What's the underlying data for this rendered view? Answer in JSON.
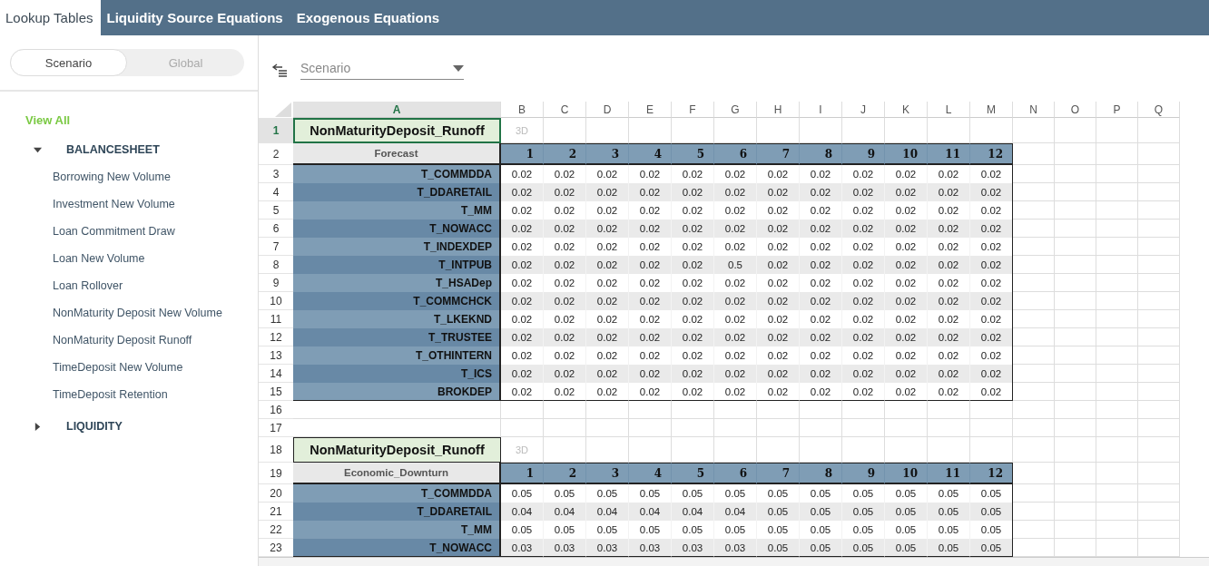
{
  "tabs": [
    {
      "label": "Lookup Tables",
      "selected": true
    },
    {
      "label": "Liquidity Source Equations",
      "selected": false
    },
    {
      "label": "Exogenous Equations",
      "selected": false
    }
  ],
  "sidebar": {
    "toggle": [
      {
        "label": "Scenario",
        "selected": true
      },
      {
        "label": "Global",
        "selected": false
      }
    ],
    "view_all": "View All",
    "tree": [
      {
        "label": "BALANCESHEET",
        "expanded": true,
        "children": [
          {
            "label": "Borrowing New Volume"
          },
          {
            "label": "Investment New Volume"
          },
          {
            "label": "Loan Commitment Draw"
          },
          {
            "label": "Loan New Volume"
          },
          {
            "label": "Loan Rollover"
          },
          {
            "label": "NonMaturity Deposit New Volume"
          },
          {
            "label": "NonMaturity Deposit Runoff"
          },
          {
            "label": "TimeDeposit New Volume"
          },
          {
            "label": "TimeDeposit Retention"
          }
        ]
      },
      {
        "label": "LIQUIDITY",
        "expanded": false
      }
    ]
  },
  "toolbar": {
    "dropdown": "Scenario"
  },
  "sheet": {
    "columns": [
      {
        "letter": "A",
        "selected": true
      },
      {
        "letter": "B",
        "selected": false
      },
      {
        "letter": "C",
        "selected": false
      },
      {
        "letter": "D",
        "selected": false
      },
      {
        "letter": "E",
        "selected": false
      },
      {
        "letter": "F",
        "selected": false
      },
      {
        "letter": "G",
        "selected": false
      },
      {
        "letter": "H",
        "selected": false
      },
      {
        "letter": "I",
        "selected": false
      },
      {
        "letter": "J",
        "selected": false
      },
      {
        "letter": "K",
        "selected": false
      },
      {
        "letter": "L",
        "selected": false
      },
      {
        "letter": "M",
        "selected": false
      },
      {
        "letter": "N",
        "selected": false
      },
      {
        "letter": "O",
        "selected": false
      },
      {
        "letter": "P",
        "selected": false
      },
      {
        "letter": "Q",
        "selected": false
      }
    ],
    "rows": [
      {
        "number": "1",
        "kind": "title",
        "selected": true,
        "label": "NonMaturityDeposit_Runoff",
        "tag": "3D"
      },
      {
        "number": "2",
        "kind": "header",
        "selected": false,
        "label": "Forecast",
        "values": [
          "1",
          "2",
          "3",
          "4",
          "5",
          "6",
          "7",
          "8",
          "9",
          "10",
          "11",
          "12"
        ]
      },
      {
        "number": "3",
        "kind": "data",
        "selected": false,
        "label": "T_COMMDDA",
        "values": [
          "0.02",
          "0.02",
          "0.02",
          "0.02",
          "0.02",
          "0.02",
          "0.02",
          "0.02",
          "0.02",
          "0.02",
          "0.02",
          "0.02"
        ]
      },
      {
        "number": "4",
        "kind": "data",
        "selected": false,
        "label": "T_DDARETAIL",
        "values": [
          "0.02",
          "0.02",
          "0.02",
          "0.02",
          "0.02",
          "0.02",
          "0.02",
          "0.02",
          "0.02",
          "0.02",
          "0.02",
          "0.02"
        ]
      },
      {
        "number": "5",
        "kind": "data",
        "selected": false,
        "label": "T_MM",
        "values": [
          "0.02",
          "0.02",
          "0.02",
          "0.02",
          "0.02",
          "0.02",
          "0.02",
          "0.02",
          "0.02",
          "0.02",
          "0.02",
          "0.02"
        ]
      },
      {
        "number": "6",
        "kind": "data",
        "selected": false,
        "label": "T_NOWACC",
        "values": [
          "0.02",
          "0.02",
          "0.02",
          "0.02",
          "0.02",
          "0.02",
          "0.02",
          "0.02",
          "0.02",
          "0.02",
          "0.02",
          "0.02"
        ]
      },
      {
        "number": "7",
        "kind": "data",
        "selected": false,
        "label": "T_INDEXDEP",
        "values": [
          "0.02",
          "0.02",
          "0.02",
          "0.02",
          "0.02",
          "0.02",
          "0.02",
          "0.02",
          "0.02",
          "0.02",
          "0.02",
          "0.02"
        ]
      },
      {
        "number": "8",
        "kind": "data",
        "selected": false,
        "label": "T_INTPUB",
        "values": [
          "0.02",
          "0.02",
          "0.02",
          "0.02",
          "0.02",
          "0.5",
          "0.02",
          "0.02",
          "0.02",
          "0.02",
          "0.02",
          "0.02"
        ]
      },
      {
        "number": "9",
        "kind": "data",
        "selected": false,
        "label": "T_HSADep",
        "values": [
          "0.02",
          "0.02",
          "0.02",
          "0.02",
          "0.02",
          "0.02",
          "0.02",
          "0.02",
          "0.02",
          "0.02",
          "0.02",
          "0.02"
        ]
      },
      {
        "number": "10",
        "kind": "data",
        "selected": false,
        "label": "T_COMMCHCK",
        "values": [
          "0.02",
          "0.02",
          "0.02",
          "0.02",
          "0.02",
          "0.02",
          "0.02",
          "0.02",
          "0.02",
          "0.02",
          "0.02",
          "0.02"
        ]
      },
      {
        "number": "11",
        "kind": "data",
        "selected": false,
        "label": "T_LKEKND",
        "values": [
          "0.02",
          "0.02",
          "0.02",
          "0.02",
          "0.02",
          "0.02",
          "0.02",
          "0.02",
          "0.02",
          "0.02",
          "0.02",
          "0.02"
        ]
      },
      {
        "number": "12",
        "kind": "data",
        "selected": false,
        "label": "T_TRUSTEE",
        "values": [
          "0.02",
          "0.02",
          "0.02",
          "0.02",
          "0.02",
          "0.02",
          "0.02",
          "0.02",
          "0.02",
          "0.02",
          "0.02",
          "0.02"
        ]
      },
      {
        "number": "13",
        "kind": "data",
        "selected": false,
        "label": "T_OTHINTERN",
        "values": [
          "0.02",
          "0.02",
          "0.02",
          "0.02",
          "0.02",
          "0.02",
          "0.02",
          "0.02",
          "0.02",
          "0.02",
          "0.02",
          "0.02"
        ]
      },
      {
        "number": "14",
        "kind": "data",
        "selected": false,
        "label": "T_ICS",
        "values": [
          "0.02",
          "0.02",
          "0.02",
          "0.02",
          "0.02",
          "0.02",
          "0.02",
          "0.02",
          "0.02",
          "0.02",
          "0.02",
          "0.02"
        ]
      },
      {
        "number": "15",
        "kind": "data",
        "selected": false,
        "label": "BROKDEP",
        "values": [
          "0.02",
          "0.02",
          "0.02",
          "0.02",
          "0.02",
          "0.02",
          "0.02",
          "0.02",
          "0.02",
          "0.02",
          "0.02",
          "0.02"
        ]
      },
      {
        "number": "16",
        "kind": "empty",
        "selected": false
      },
      {
        "number": "17",
        "kind": "empty",
        "selected": false
      },
      {
        "number": "18",
        "kind": "title",
        "selected": false,
        "label": "NonMaturityDeposit_Runoff",
        "tag": "3D"
      },
      {
        "number": "19",
        "kind": "header",
        "selected": false,
        "label": "Economic_Downturn",
        "values": [
          "1",
          "2",
          "3",
          "4",
          "5",
          "6",
          "7",
          "8",
          "9",
          "10",
          "11",
          "12"
        ]
      },
      {
        "number": "20",
        "kind": "data",
        "selected": false,
        "label": "T_COMMDDA",
        "values": [
          "0.05",
          "0.05",
          "0.05",
          "0.05",
          "0.05",
          "0.05",
          "0.05",
          "0.05",
          "0.05",
          "0.05",
          "0.05",
          "0.05"
        ]
      },
      {
        "number": "21",
        "kind": "data",
        "selected": false,
        "label": "T_DDARETAIL",
        "values": [
          "0.04",
          "0.04",
          "0.04",
          "0.04",
          "0.04",
          "0.04",
          "0.05",
          "0.05",
          "0.05",
          "0.05",
          "0.05",
          "0.05"
        ]
      },
      {
        "number": "22",
        "kind": "data",
        "selected": false,
        "label": "T_MM",
        "values": [
          "0.05",
          "0.05",
          "0.05",
          "0.05",
          "0.05",
          "0.05",
          "0.05",
          "0.05",
          "0.05",
          "0.05",
          "0.05",
          "0.05"
        ]
      },
      {
        "number": "23",
        "kind": "data",
        "selected": false,
        "label": "T_NOWACC",
        "values": [
          "0.03",
          "0.03",
          "0.03",
          "0.03",
          "0.03",
          "0.03",
          "0.05",
          "0.05",
          "0.05",
          "0.05",
          "0.05",
          "0.05"
        ]
      }
    ]
  }
}
